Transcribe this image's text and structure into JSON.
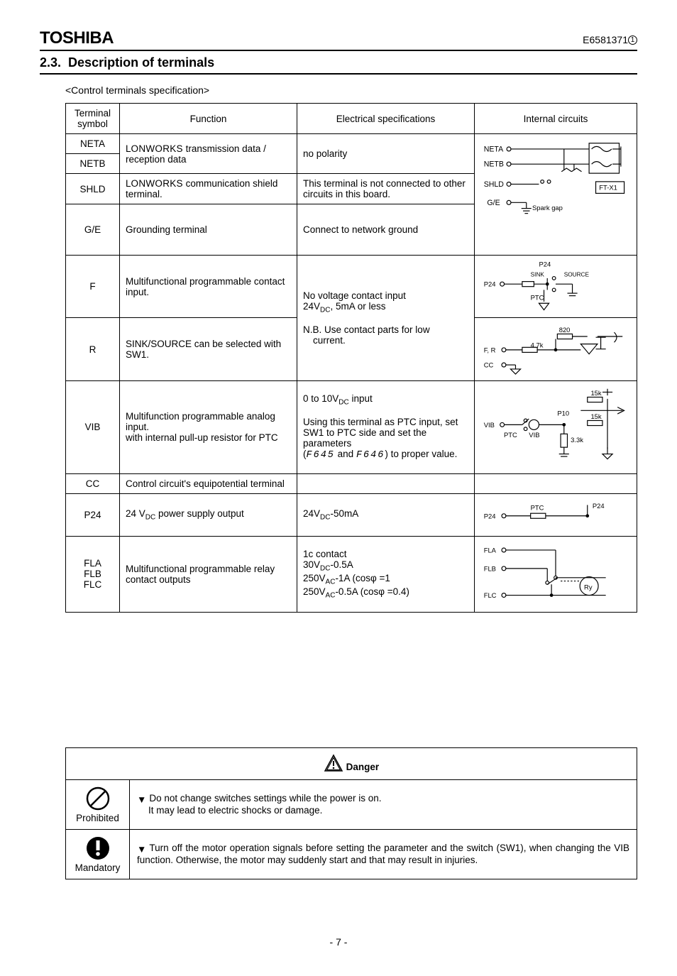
{
  "header": {
    "brand": "TOSHIBA",
    "doc_id": "E6581371",
    "doc_rev": "①"
  },
  "section": {
    "number": "2.3.",
    "title": "Description of terminals",
    "subhead": "<Control terminals specification>"
  },
  "table": {
    "headers": {
      "symbol": "Terminal symbol",
      "function": "Function",
      "spec": "Electrical specifications",
      "circuit": "Internal circuits"
    },
    "rows": {
      "neta": {
        "symbol": "NETA"
      },
      "netb": {
        "symbol": "NETB"
      },
      "net_func_a": "L",
      "net_func_b": " transmission data / reception data",
      "net_func_sc": "ONWORKS",
      "net_spec": "no polarity",
      "shld": {
        "symbol": "SHLD",
        "func_pre": "L",
        "func_sc": "ONWORKS",
        "func_post": " communication shield terminal.",
        "spec": "This terminal is not connected to other circuits in this board."
      },
      "ge": {
        "symbol": "G/E",
        "func": "Grounding terminal",
        "spec": "Connect to network ground"
      },
      "f": {
        "symbol": "F",
        "func": "Multifunctional programmable contact input.",
        "spec_line1": "No voltage contact input",
        "spec_line2a": "24V",
        "spec_line2b": ", 5mA or less"
      },
      "r": {
        "symbol": "R",
        "func": "SINK/SOURCE can be selected with SW1.",
        "spec_line1": "N.B. Use contact parts for low",
        "spec_line2": "current."
      },
      "vib": {
        "symbol": "VIB",
        "func": "Multifunction programmable analog input.\nwith internal pull-up resistor for PTC",
        "spec_l1a": "0 to 10V",
        "spec_l1b": " input",
        "spec_l2": "Using this terminal as PTC input, set SW1 to PTC side and set the parameters",
        "spec_l3a": "(",
        "spec_l3b": " and ",
        "spec_l3c": ") to proper value.",
        "code1": "F645",
        "code2": "F646"
      },
      "cc": {
        "symbol": "CC",
        "func": "Control circuit's equipotential terminal"
      },
      "p24": {
        "symbol": "P24",
        "func_a": "24 V",
        "func_b": " power supply output",
        "spec_a": "24V",
        "spec_b": "-50mA"
      },
      "fl": {
        "s1": "FLA",
        "s2": "FLB",
        "s3": "FLC",
        "func": "Multifunctional programmable relay contact outputs",
        "spec_l1": "1c contact",
        "spec_l2a": "30V",
        "spec_l2b": "-0.5A",
        "spec_l3a": " 250V",
        "spec_l3b": "-1A (cosφ =1",
        "spec_l4a": " 250V",
        "spec_l4b": "-0.5A (cosφ =0.4)"
      }
    },
    "circuit_labels": {
      "net": {
        "a": "NETA",
        "b": "NETB",
        "s": "SHLD",
        "g": "G/E",
        "ft": "FT-X1",
        "spark": "Spark gap"
      },
      "f": {
        "p24": "P24",
        "sink": "SINK",
        "source": "SOURCE",
        "ptc": "PTC"
      },
      "r": {
        "r820": "820",
        "r47": "4.7k",
        "fr": "F, R",
        "cc": "CC"
      },
      "vib": {
        "r15a": "15k",
        "r15b": "15k",
        "p10": "P10",
        "vib": "VIB",
        "ptc": "PTC",
        "sw": "VIB",
        "r33": "3.3k"
      },
      "p24": {
        "p24a": "P24",
        "p24b": "P24",
        "ptc": "PTC"
      },
      "fl": {
        "a": "FLA",
        "b": "FLB",
        "c": "FLC",
        "ry": "Ry"
      }
    }
  },
  "danger": {
    "title": "Danger",
    "prohibited": {
      "label": "Prohibited",
      "l1": "Do not change switches settings while the power is on.",
      "l2": "It may lead to electric shocks or damage."
    },
    "mandatory": {
      "label": "Mandatory",
      "text": "Turn off the motor operation signals before setting the parameter and the switch (SW1), when changing the VIB function. Otherwise, the motor may suddenly start and that may result in injuries."
    }
  },
  "page": "- 7 -"
}
